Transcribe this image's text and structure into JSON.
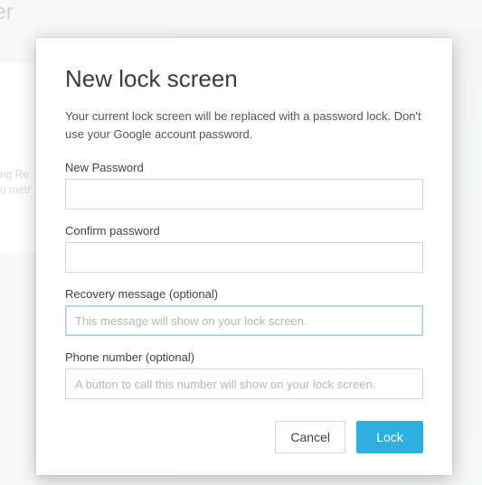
{
  "background": {
    "title_fragment": "ger",
    "side_line1": "ng Re",
    "side_line2": "o metr"
  },
  "dialog": {
    "title": "New lock screen",
    "description": "Your current lock screen will be replaced with a password lock. Don't use your Google account password.",
    "fields": {
      "new_password": {
        "label": "New Password",
        "value": "",
        "placeholder": ""
      },
      "confirm_password": {
        "label": "Confirm password",
        "value": "",
        "placeholder": ""
      },
      "recovery_message": {
        "label": "Recovery message (optional)",
        "value": "",
        "placeholder": "This message will show on your lock screen."
      },
      "phone_number": {
        "label": "Phone number (optional)",
        "value": "",
        "placeholder": "A button to call this number will show on your lock screen."
      }
    },
    "buttons": {
      "cancel": "Cancel",
      "lock": "Lock"
    }
  }
}
